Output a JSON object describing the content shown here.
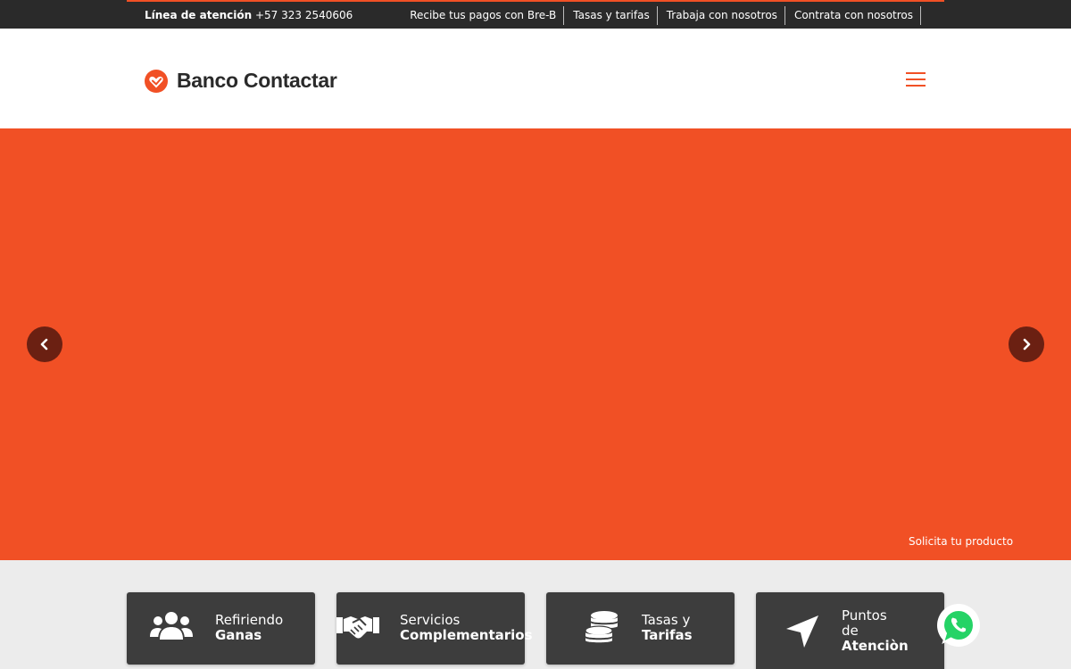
{
  "topbar": {
    "phone_label": "Línea de atención",
    "phone_number": "+57 323 2540606",
    "links": [
      "Recibe tus pagos con Bre-B",
      "Tasas y tarifas",
      "Trabaja con nosotros",
      "Contrata con nosotros"
    ]
  },
  "header": {
    "brand": "Banco Contactar",
    "menu_icon": "hamburger-icon"
  },
  "hero": {
    "cta": "Solicita tu producto",
    "prev_icon": "chevron-left-icon",
    "next_icon": "chevron-right-icon"
  },
  "quick_links": [
    {
      "line1": "Refiriendo",
      "line2": "Ganas",
      "icon": "users-icon"
    },
    {
      "line1": "Servicios",
      "line2": "Complementarios",
      "icon": "handshake-icon"
    },
    {
      "line1": "Tasas y",
      "line2": "Tarifas",
      "icon": "coins-icon"
    },
    {
      "line1": "Puntos",
      "line1b": "de",
      "line2": "Atenciòn",
      "icon": "location-arrow-icon"
    }
  ],
  "whatsapp_icon": "whatsapp-icon",
  "colors": {
    "brand_orange": "#f15025",
    "dark": "#2a2a2a",
    "card": "#3d3d3d",
    "section_bg": "#ececec",
    "whatsapp_green": "#25d366"
  }
}
